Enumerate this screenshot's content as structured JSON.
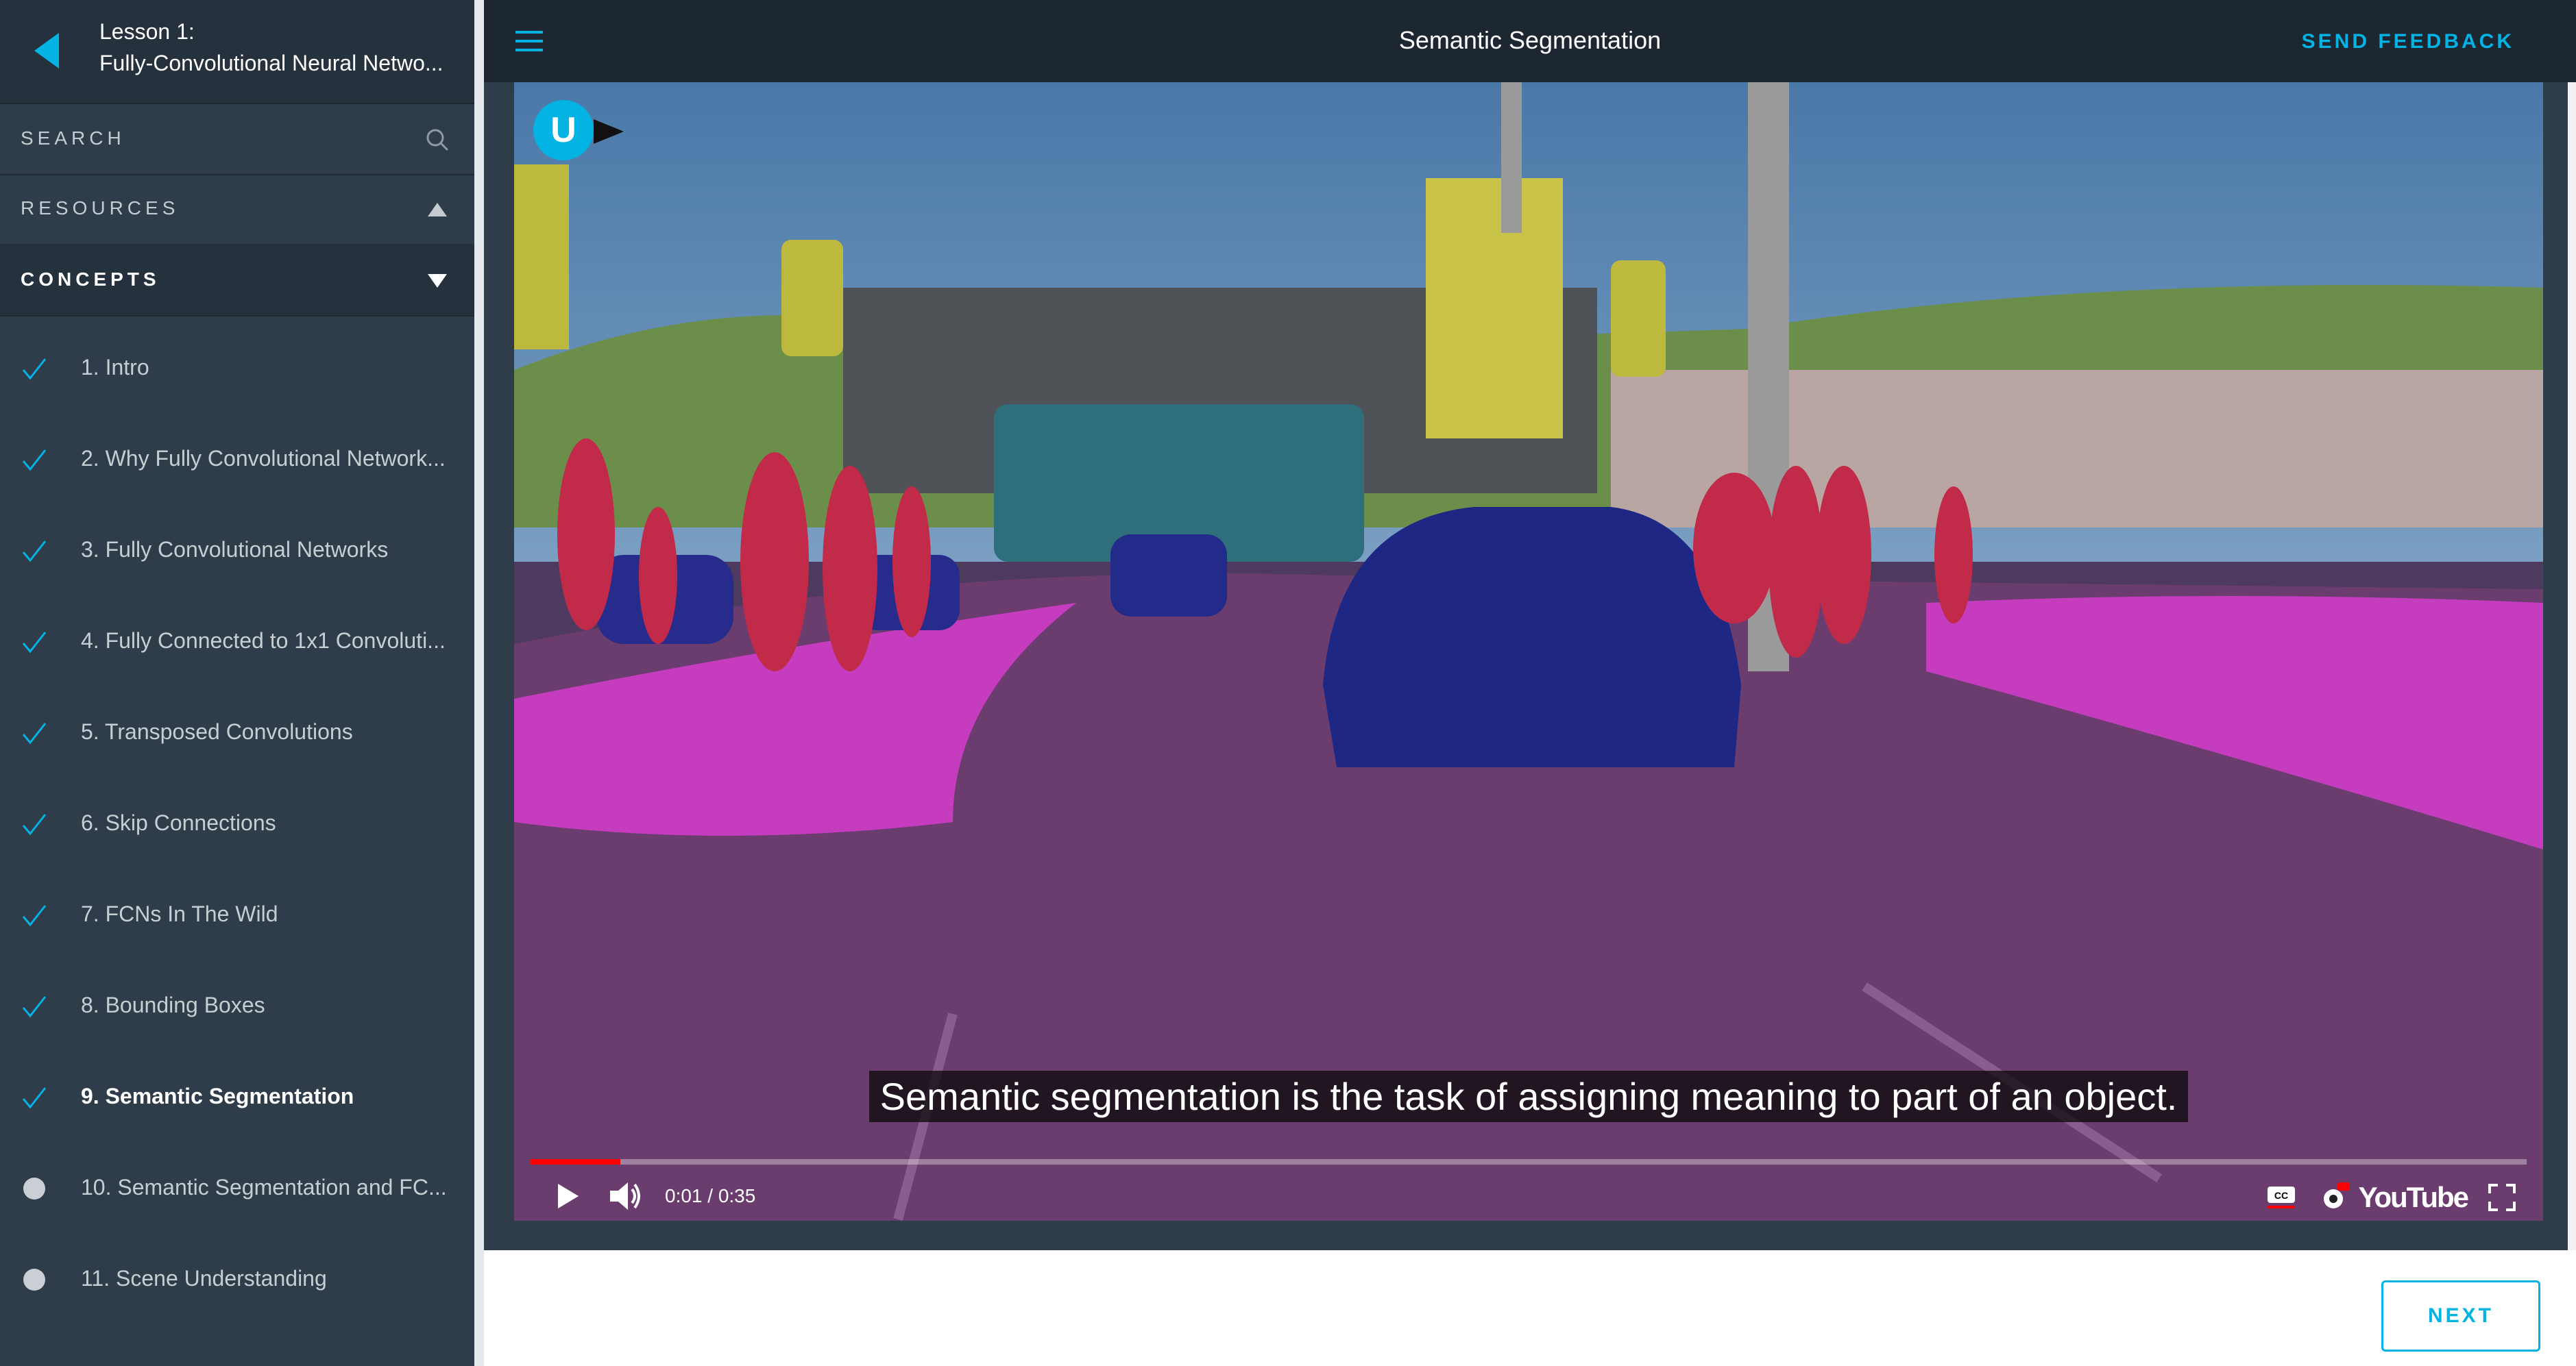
{
  "lesson": {
    "number_label": "Lesson 1:",
    "title": "Fully-Convolutional Neural Netwo..."
  },
  "sidebar": {
    "search_label": "SEARCH",
    "resources_label": "RESOURCES",
    "concepts_label": "CONCEPTS",
    "concepts": [
      {
        "label": "1. Intro",
        "status": "completed"
      },
      {
        "label": "2. Why Fully Convolutional Network...",
        "status": "completed"
      },
      {
        "label": "3. Fully Convolutional Networks",
        "status": "completed"
      },
      {
        "label": "4. Fully Connected to 1x1 Convoluti...",
        "status": "completed"
      },
      {
        "label": "5. Transposed Convolutions",
        "status": "completed"
      },
      {
        "label": "6. Skip Connections",
        "status": "completed"
      },
      {
        "label": "7. FCNs In The Wild",
        "status": "completed"
      },
      {
        "label": "8. Bounding Boxes",
        "status": "completed"
      },
      {
        "label": "9. Semantic Segmentation",
        "status": "completed-active"
      },
      {
        "label": "10. Semantic Segmentation and FC...",
        "status": "incomplete"
      },
      {
        "label": "11. Scene Understanding",
        "status": "incomplete"
      }
    ]
  },
  "header": {
    "title": "Semantic Segmentation",
    "feedback_label": "SEND FEEDBACK"
  },
  "video": {
    "logo_letter": "U",
    "subtitle": "Semantic segmentation is the task of assigning meaning to part of an object.",
    "time": "0:01 / 0:35",
    "progress_fraction": 0.045,
    "platform_label": "YouTube"
  },
  "footer": {
    "next_label": "NEXT"
  },
  "colors": {
    "accent": "#02b3e4",
    "sidebar_bg": "#2e3d49",
    "topbar_bg": "#1d2732",
    "check": "#02b3e4",
    "progress": "#ff0000"
  }
}
